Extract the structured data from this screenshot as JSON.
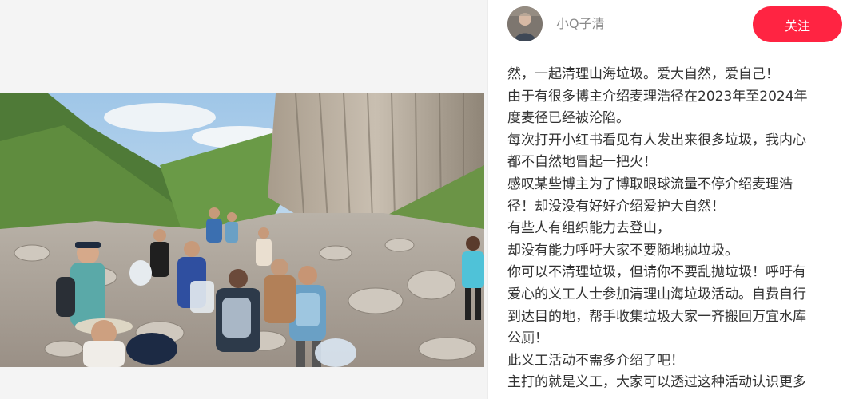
{
  "author": {
    "name": "小Q子清",
    "follow_label": "关注"
  },
  "post": {
    "lines": [
      "然，一起清理山海垃圾。爱大自然，爱自己！",
      "由于有很多博主介绍麦理浩径在2023年至2024年",
      "度麦径已经被沦陷。",
      "每次打开小红书看见有人发出来很多垃圾，我内心",
      "都不自然地冒起一把火！",
      "感叹某些博主为了博取眼球流量不停介绍麦理浩",
      "径！却没没有好好介绍爱护大自然！",
      "有些人有组织能力去登山，",
      "却没有能力呼吁大家不要随地抛垃圾。",
      "你可以不清理垃圾，但请你不要乱抛垃圾！呼吁有",
      "爱心的义工人士参加清理山海垃圾活动。自费自行",
      "到达目的地，帮手收集垃圾大家一齐搬回万宜水库",
      "公厕！",
      "此义工活动不需多介绍了吧！",
      "主打的就是义工，大家可以透过这种活动认识更多"
    ]
  },
  "colors": {
    "accent": "#ff2442",
    "text": "#333333",
    "muted": "#8a8a8a"
  }
}
